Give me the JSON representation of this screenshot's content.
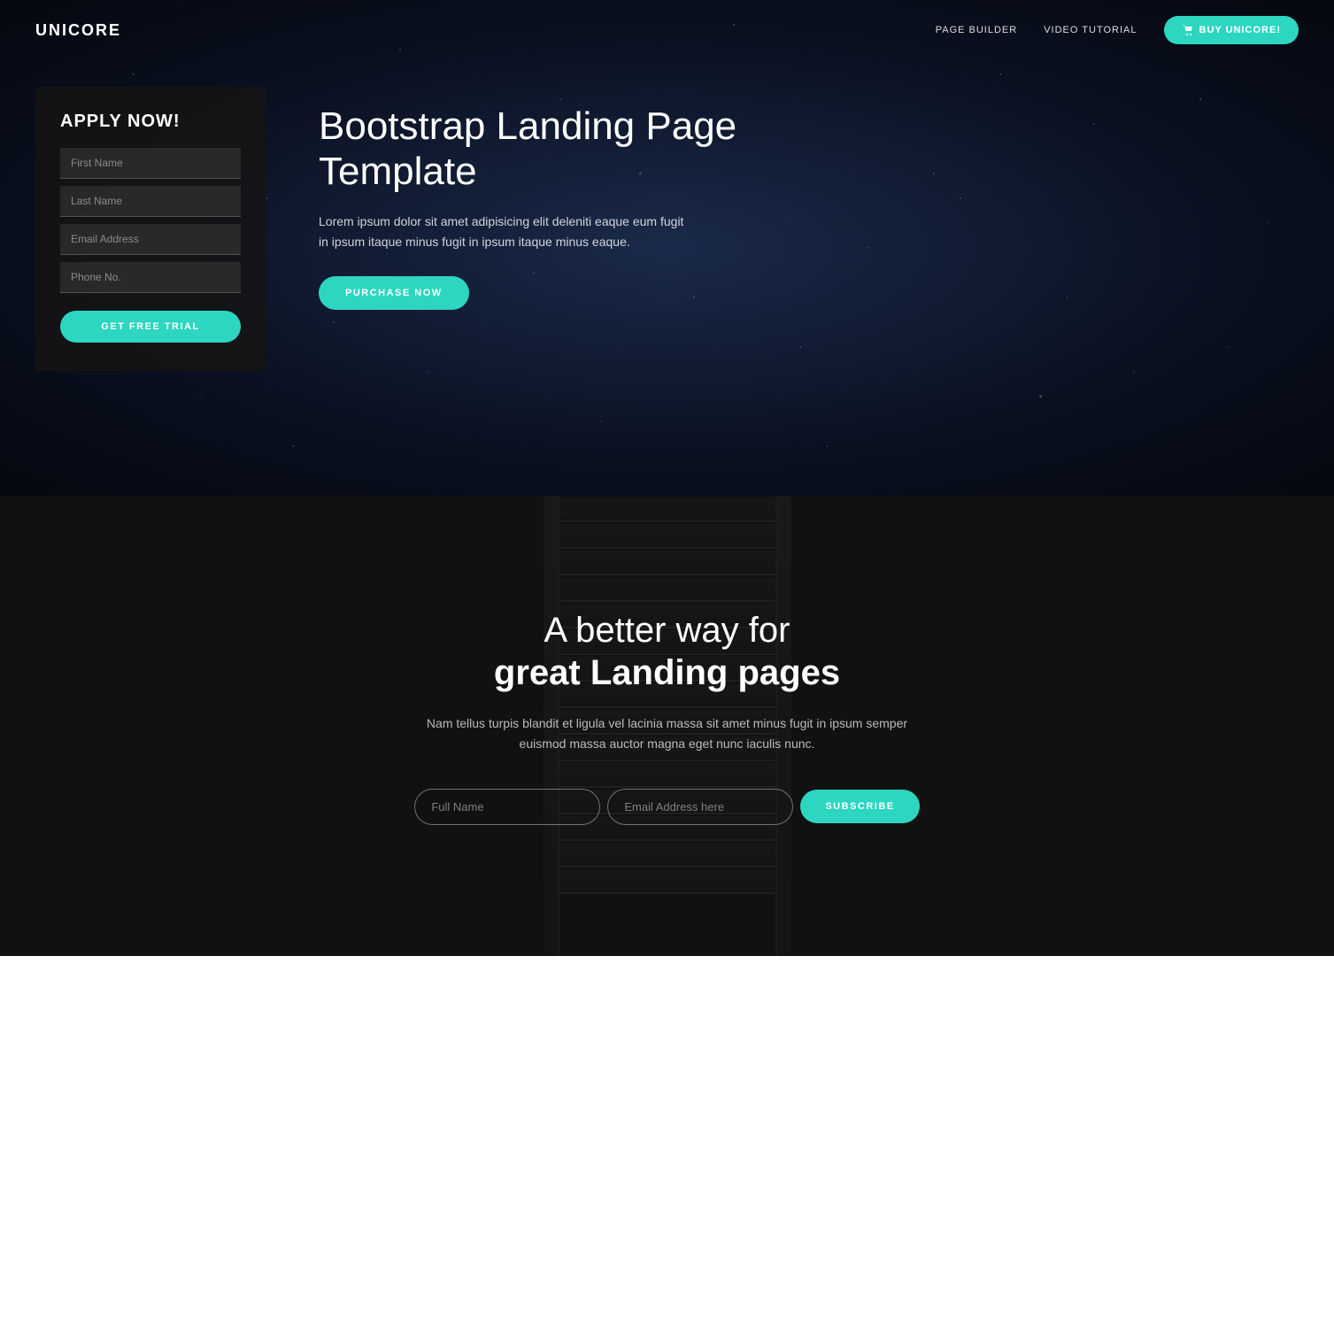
{
  "brand": {
    "name": "UNICORE"
  },
  "navbar": {
    "links": [
      {
        "label": "PAGE BUILDER"
      },
      {
        "label": "VIDEO TUTORIAL"
      }
    ],
    "cta_label": "BUY UNICORE!"
  },
  "hero": {
    "form": {
      "title": "APPLY NOW!",
      "fields": [
        {
          "placeholder": "First Name"
        },
        {
          "placeholder": "Last Name"
        },
        {
          "placeholder": "Email Address"
        },
        {
          "placeholder": "Phone No."
        }
      ],
      "button_label": "GET FREE TRIAL"
    },
    "heading": "Bootstrap Landing Page Template",
    "description": "Lorem ipsum dolor sit amet adipisicing elit deleniti eaque eum fugit in ipsum itaque minus fugit in ipsum itaque minus eaque.",
    "cta_label": "PURCHASE NOW"
  },
  "escalator_section": {
    "heading_line1": "A better way for",
    "heading_line2": "great Landing pages",
    "description": "Nam tellus turpis blandit et ligula vel lacinia massa sit amet minus fugit in ipsum semper euismod massa auctor magna eget nunc iaculis nunc.",
    "full_name_placeholder": "Full Name",
    "email_placeholder": "Email Address here",
    "subscribe_label": "SUBSCRIBE"
  },
  "colors": {
    "accent": "#2dd6c0",
    "dark_bg": "#111111",
    "hero_bg": "#0a1628"
  }
}
